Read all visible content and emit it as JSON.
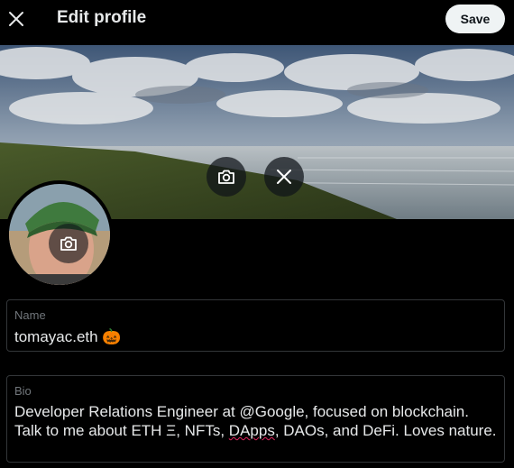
{
  "header": {
    "title": "Edit profile",
    "save_label": "Save",
    "close_icon": "close-icon"
  },
  "banner": {
    "camera_icon": "camera-icon",
    "remove_icon": "close-icon"
  },
  "avatar": {
    "camera_icon": "camera-icon"
  },
  "form": {
    "name": {
      "label": "Name",
      "value": "tomayac.eth 🎃"
    },
    "bio": {
      "label": "Bio",
      "value_part1": "Developer Relations Engineer at @Google, focused on blockchain. Talk to me about ETH Ξ, NFTs, ",
      "value_misspelled": "DApps",
      "value_part2": ", DAOs, and DeFi. Loves nature."
    }
  },
  "colors": {
    "background": "#000000",
    "text": "#e7e9ea",
    "muted": "#71767b",
    "border": "#333639",
    "save_bg": "#eff3f4"
  }
}
